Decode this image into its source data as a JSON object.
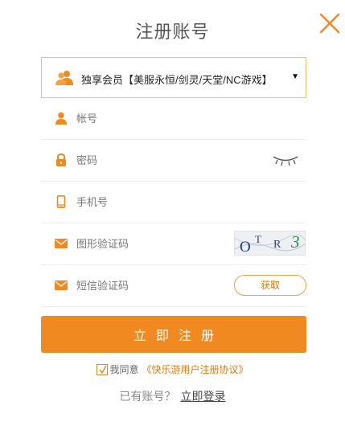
{
  "header": {
    "title": "注册账号"
  },
  "member_select": {
    "selected": "独享会员【美服永恒/剑灵/天堂/NC游戏】",
    "caret": "▼"
  },
  "fields": {
    "account_placeholder": "帐号",
    "password_placeholder": "密码",
    "phone_placeholder": "手机号",
    "image_code_placeholder": "图形验证码",
    "sms_code_placeholder": "短信验证码"
  },
  "captcha": {
    "chars": [
      "O",
      "T",
      "R",
      "3"
    ]
  },
  "sms": {
    "get_code_label": "获取"
  },
  "submit": {
    "label": "立即注册"
  },
  "agreement": {
    "prefix": "我同意",
    "link": "《快乐游用户注册协议》"
  },
  "login": {
    "prompt": "已有账号？",
    "link": "立即登录"
  },
  "colors": {
    "accent": "#f0891f",
    "accent_dark": "#e07b10",
    "border": "#f0c06a"
  }
}
